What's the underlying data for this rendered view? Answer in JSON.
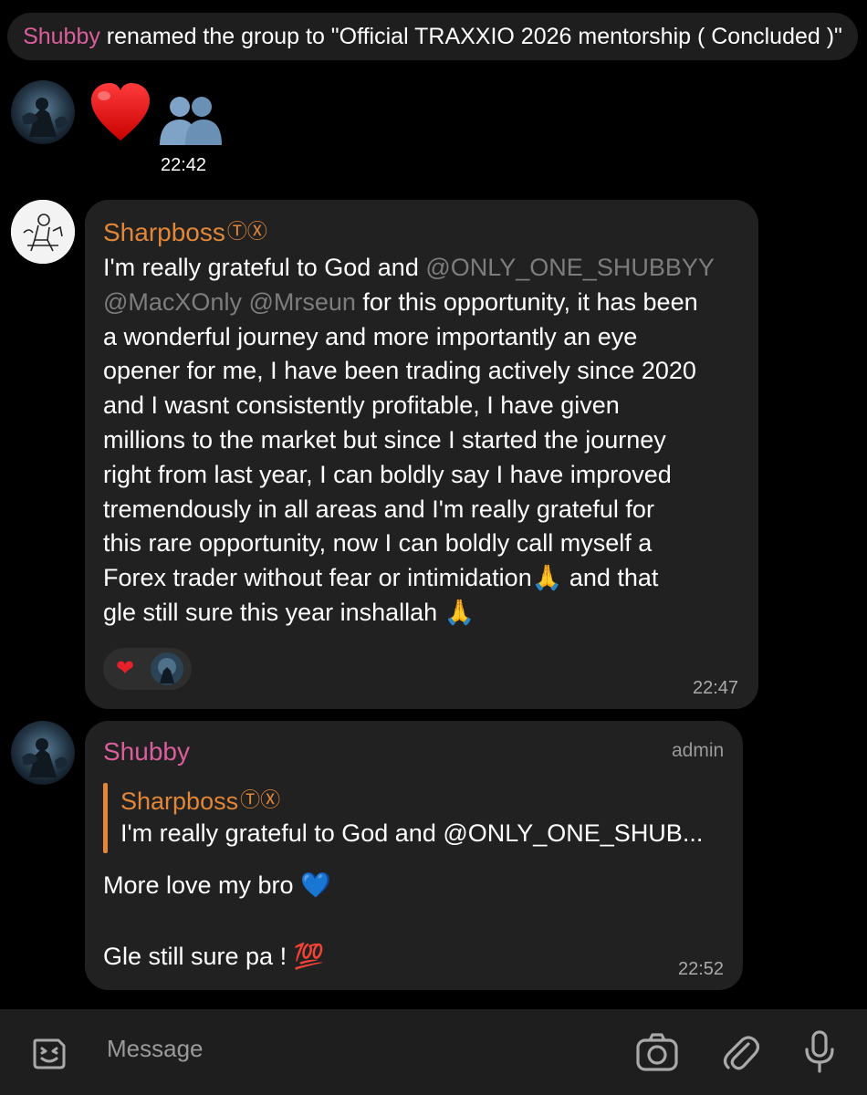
{
  "service_message": {
    "actor": "Shubby",
    "text": " renamed the group to \"Official TRAXXIO 2026 mentorship ( Concluded )\""
  },
  "sticker_message": {
    "time": "22:42"
  },
  "message1": {
    "sender": "Sharpboss",
    "badge": "ⓉⓍ",
    "lines": [
      {
        "a": "I'm really grateful to God and ",
        "m": "@ONLY_ONE_SHUBBYY",
        "b": ""
      },
      {
        "a": "",
        "m": "@MacXOnly @Mrseun",
        "b": " for this opportunity, it has been"
      },
      {
        "a": "a wonderful journey and more importantly an eye",
        "m": "",
        "b": ""
      },
      {
        "a": "opener for me, I have been trading actively since 2020",
        "m": "",
        "b": ""
      },
      {
        "a": "and I wasnt consistently profitable, I have given",
        "m": "",
        "b": ""
      },
      {
        "a": "millions to the market but since I started the journey",
        "m": "",
        "b": ""
      },
      {
        "a": "right from last year, I can boldly say I have improved",
        "m": "",
        "b": ""
      },
      {
        "a": "tremendously in all areas and I'm really grateful for",
        "m": "",
        "b": ""
      },
      {
        "a": "this rare opportunity, now I can boldly call myself a",
        "m": "",
        "b": ""
      },
      {
        "a": "Forex trader without fear or intimidation🙏 and that",
        "m": "",
        "b": ""
      },
      {
        "a": "gle still sure this year inshallah 🙏",
        "m": "",
        "b": ""
      }
    ],
    "reaction": "❤",
    "time": "22:47"
  },
  "message2": {
    "sender": "Shubby",
    "role": "admin",
    "reply_sender": "Sharpboss",
    "reply_badge": "ⓉⓍ",
    "reply_text": "I'm really grateful to God and @ONLY_ONE_SHUB...",
    "line1": "More love my bro 💙",
    "line2": "Gle still sure pa ! 💯",
    "time": "22:52"
  },
  "composer": {
    "placeholder": "Message"
  },
  "colors": {
    "background": "#000000",
    "bubble": "#212121",
    "sender_orange": "#e28637",
    "sender_pink": "#d95f9c",
    "mention": "#7d7d7d"
  }
}
